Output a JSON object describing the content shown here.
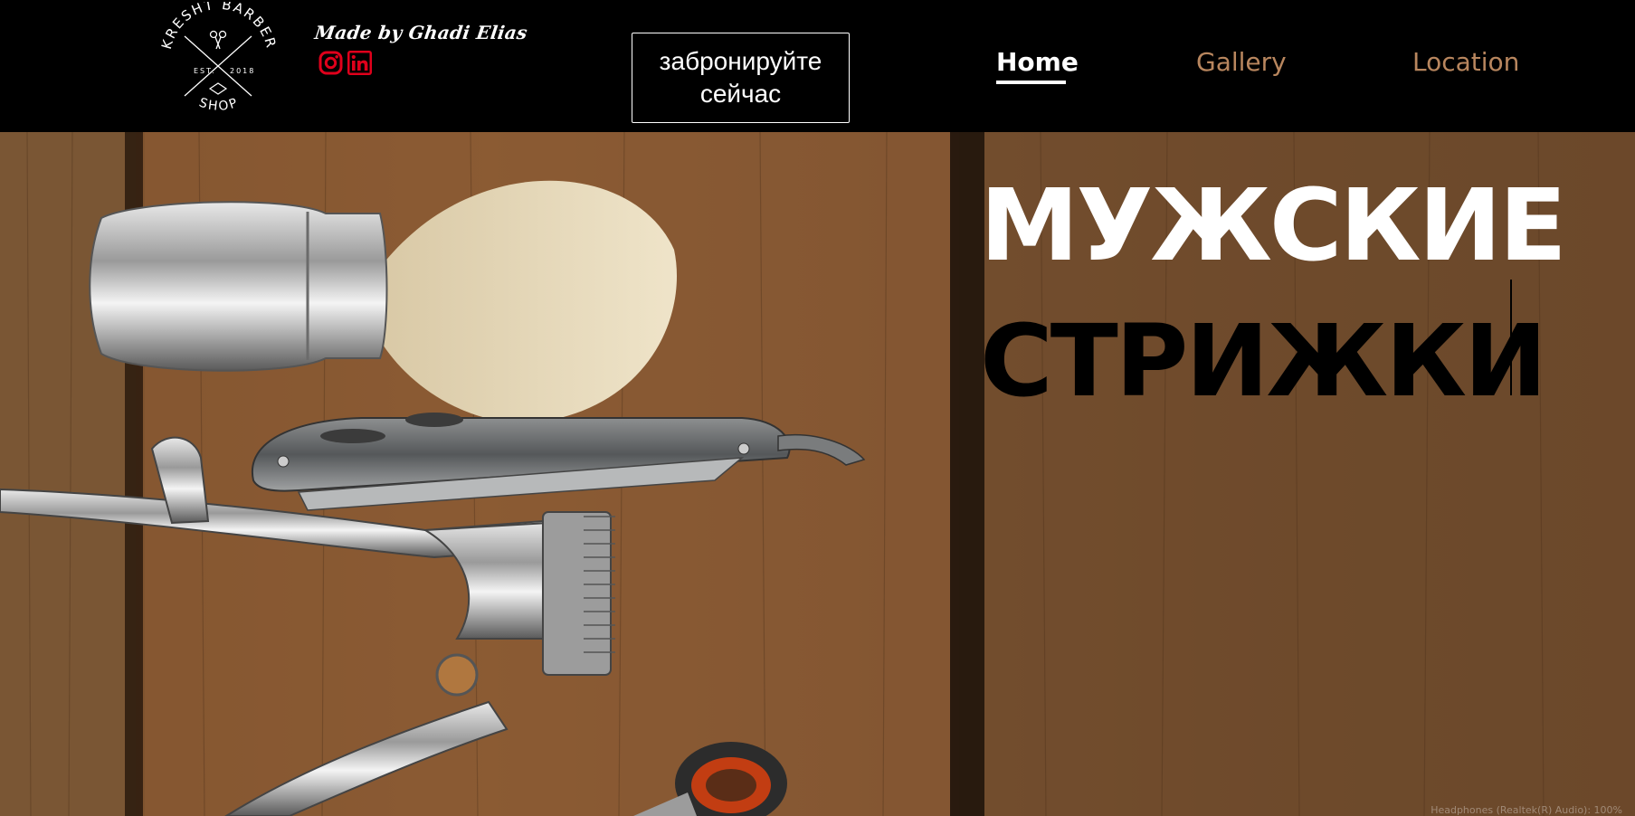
{
  "brand": {
    "logo_top": "KRESHT BARBER",
    "logo_left": "EST.",
    "logo_right": "2018",
    "logo_bottom": "SHOP",
    "credit": "Made by Ghadi Elias"
  },
  "social": [
    {
      "icon": "instagram-icon",
      "color": "#e0001b"
    },
    {
      "icon": "linkedin-icon",
      "color": "#e0001b"
    }
  ],
  "cta": {
    "label": "забронируйте сейчас"
  },
  "nav": {
    "items": [
      {
        "label": "Home",
        "active": true
      },
      {
        "label": "Gallery",
        "active": false
      },
      {
        "label": "Location",
        "active": false
      }
    ]
  },
  "hero": {
    "headline_line1": "МУЖСКИЕ",
    "headline_line2": "СТРИЖКИ"
  },
  "status_bar": {
    "text": "Headphones (Realtek(R) Audio): 100%"
  },
  "colors": {
    "header_bg": "#000000",
    "nav_link": "#b8865e",
    "nav_active": "#ffffff",
    "wood": "#7b5231",
    "social_red": "#e0001b"
  }
}
